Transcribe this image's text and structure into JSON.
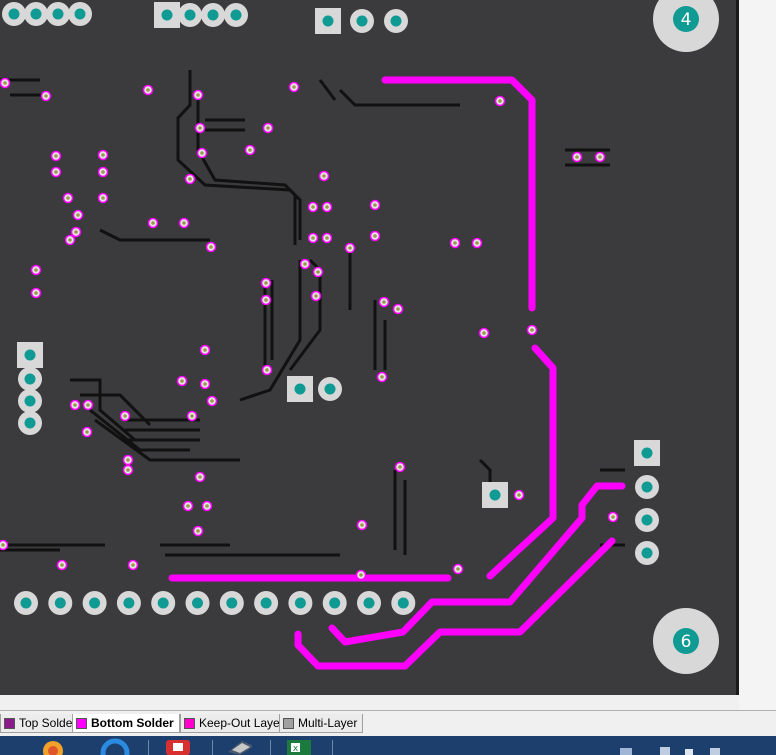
{
  "board": {
    "mounting_holes": [
      {
        "label": "4"
      },
      {
        "label": "6"
      }
    ]
  },
  "layer_tabs": [
    {
      "label": "Top Solder",
      "color": "#8b1a8b",
      "active": false
    },
    {
      "label": "Bottom Solder",
      "color": "#ff00ff",
      "active": true
    },
    {
      "label": "Keep-Out Layer",
      "color": "#ff00cc",
      "active": false
    },
    {
      "label": "Multi-Layer",
      "color": "#a0a0a0",
      "active": false
    }
  ],
  "colors": {
    "board": "#3b3b3d",
    "trace_bottom": "#ff00ff",
    "pad_teal": "#0f9a94",
    "pad_ring": "#d8d8d8",
    "track_black": "#111111"
  },
  "taskbar": {
    "items": [
      {
        "icon": "browser-icon"
      },
      {
        "icon": "app-blue-ring-icon"
      },
      {
        "icon": "app-red-icon"
      },
      {
        "icon": "pcb-tool-icon"
      },
      {
        "icon": "excel-icon"
      }
    ]
  }
}
